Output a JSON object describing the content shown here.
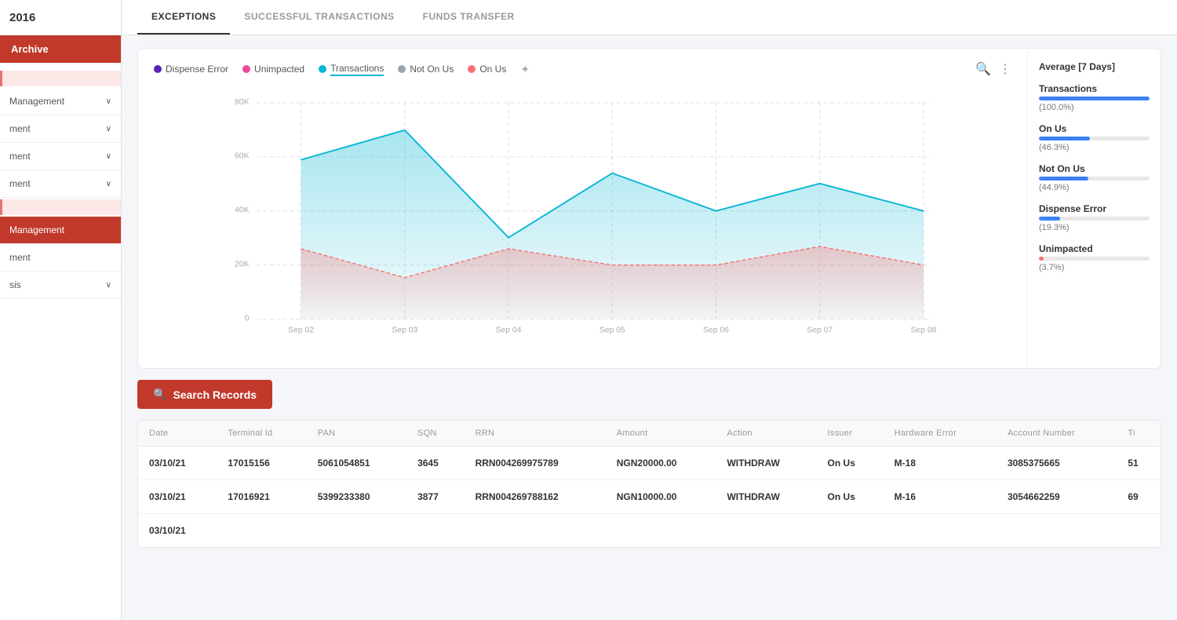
{
  "sidebar": {
    "year": "2016",
    "archive_label": "Archive",
    "items": [
      {
        "id": "management1",
        "label": "Management",
        "has_chevron": true,
        "active": false
      },
      {
        "id": "ment1",
        "label": "ment",
        "has_chevron": true,
        "active": false
      },
      {
        "id": "ment2",
        "label": "ment",
        "has_chevron": true,
        "active": false
      },
      {
        "id": "ment3",
        "label": "ment",
        "has_chevron": true,
        "active": false
      },
      {
        "id": "management2",
        "label": "Management",
        "has_chevron": false,
        "active": true
      },
      {
        "id": "ment4",
        "label": "ment",
        "has_chevron": false,
        "active": false
      },
      {
        "id": "sis",
        "label": "sis",
        "has_chevron": true,
        "active": false
      }
    ]
  },
  "tabs": [
    {
      "id": "exceptions",
      "label": "EXCEPTIONS",
      "active": true
    },
    {
      "id": "successful",
      "label": "SUCCESSFUL TRANSACTIONS",
      "active": false
    },
    {
      "id": "funds",
      "label": "FUNDS TRANSFER",
      "active": false
    }
  ],
  "chart": {
    "legend": [
      {
        "id": "dispense-error",
        "label": "Dispense Error",
        "color": "#5b21b6"
      },
      {
        "id": "unimpacted",
        "label": "Unimpacted",
        "color": "#ec4899"
      },
      {
        "id": "transactions",
        "label": "Transactions",
        "color": "#06b6d4",
        "underline": true
      },
      {
        "id": "not-on-us",
        "label": "Not On Us",
        "color": "#9ca3af"
      },
      {
        "id": "on-us",
        "label": "On Us",
        "color": "#f87171"
      }
    ],
    "yAxis": [
      "80K",
      "60K",
      "40K",
      "20K",
      "0"
    ],
    "xAxis": [
      "Sep 02",
      "Sep 03",
      "Sep 04",
      "Sep 05",
      "Sep 06",
      "Sep 07",
      "Sep 08"
    ],
    "search_icon": "🔍",
    "more_icon": "⋮"
  },
  "side_panel": {
    "title": "Average [7 Days]",
    "metrics": [
      {
        "id": "transactions",
        "label": "Transactions",
        "pct": "(100.0%)",
        "fill": 100,
        "color": "#3b82f6"
      },
      {
        "id": "on-us",
        "label": "On Us",
        "pct": "(46.3%)",
        "fill": 46,
        "color": "#3b82f6"
      },
      {
        "id": "not-on-us",
        "label": "Not On Us",
        "pct": "(44.9%)",
        "fill": 45,
        "color": "#3b82f6"
      },
      {
        "id": "dispense-error",
        "label": "Dispense Error",
        "pct": "(19.3%)",
        "fill": 19,
        "color": "#3b82f6"
      },
      {
        "id": "unimpacted",
        "label": "Unimpacted",
        "pct": "(3.7%)",
        "fill": 4,
        "color": "#f87171"
      }
    ]
  },
  "search_button": {
    "label": "Search Records",
    "icon": "🔍"
  },
  "table": {
    "headers": [
      "Date",
      "Terminal Id",
      "PAN",
      "SQN",
      "RRN",
      "Amount",
      "Action",
      "Issuer",
      "Hardware Error",
      "Account Number",
      "Ti"
    ],
    "rows": [
      {
        "date": "03/10/21",
        "terminal_id": "17015156",
        "pan": "5061054851",
        "sqn": "3645",
        "rrn": "RRN004269975789",
        "amount": "NGN20000.00",
        "action": "WITHDRAW",
        "issuer": "On Us",
        "hardware_error": "M-18",
        "account_number": "3085375665",
        "ti": "51"
      },
      {
        "date": "03/10/21",
        "terminal_id": "17016921",
        "pan": "5399233380",
        "sqn": "3877",
        "rrn": "RRN004269788162",
        "amount": "NGN10000.00",
        "action": "WITHDRAW",
        "issuer": "On Us",
        "hardware_error": "M-16",
        "account_number": "3054662259",
        "ti": "69"
      },
      {
        "date": "03/10/21",
        "terminal_id": "",
        "pan": "",
        "sqn": "",
        "rrn": "",
        "amount": "",
        "action": "",
        "issuer": "",
        "hardware_error": "",
        "account_number": "",
        "ti": ""
      }
    ]
  }
}
